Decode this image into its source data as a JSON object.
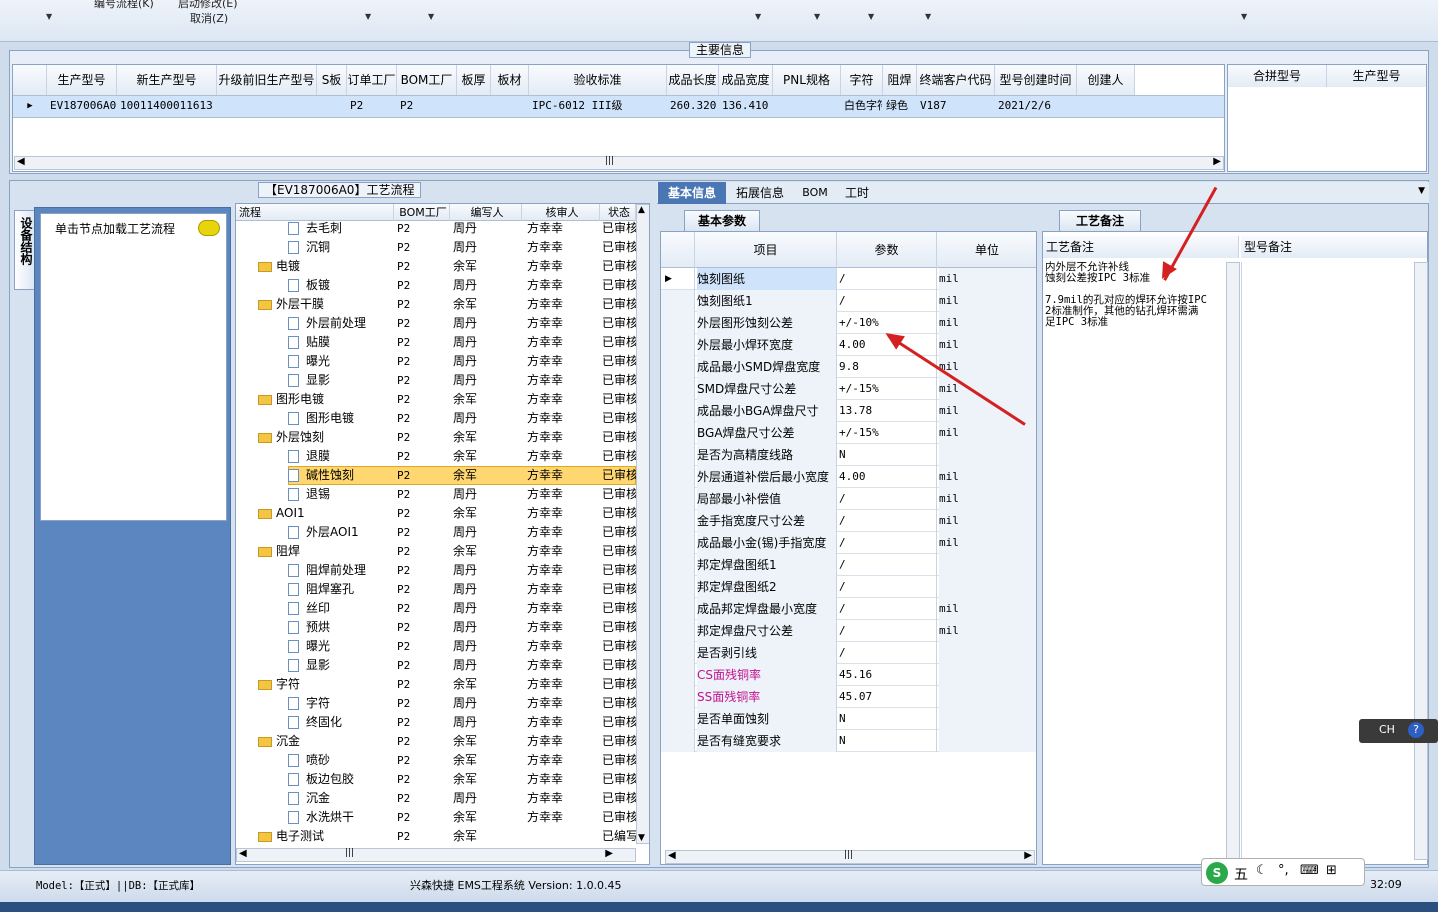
{
  "toolbar": {
    "menu1": "编号流程(K)",
    "menu2": "启动修改(E)",
    "cancel": "取消(Z)"
  },
  "main_info": {
    "group_label": "主要信息",
    "columns": [
      "生产型号",
      "新生产型号",
      "升级前旧生产型号",
      "S板",
      "订单工厂",
      "BOM工厂",
      "板厚",
      "板材",
      "验收标准",
      "成品长度",
      "成品宽度",
      "PNL规格",
      "字符",
      "阻焊",
      "终端客户代码",
      "型号创建时间",
      "创建人"
    ],
    "row": [
      "EV187006A0",
      "10011400011613",
      "",
      "",
      "P2",
      "P2",
      "",
      "",
      "IPC-6012 III级",
      "260.320",
      "136.410",
      "",
      "白色字符",
      "绿色",
      "V187",
      "2021/2/6",
      ""
    ],
    "merge_columns": [
      "合拼型号",
      "生产型号"
    ]
  },
  "left_panel": {
    "vertical_tab": "设备结构",
    "hint": "单击节点加载工艺流程"
  },
  "process": {
    "group_label": "【EV187006A0】工艺流程",
    "columns": [
      "流程",
      "BOM工厂",
      "编写人",
      "核审人",
      "状态"
    ],
    "rows": [
      {
        "name": "去毛刺",
        "level": 2,
        "f": "P2",
        "w": "周丹",
        "r": "方幸幸",
        "s": "已审核"
      },
      {
        "name": "沉铜",
        "level": 2,
        "f": "P2",
        "w": "周丹",
        "r": "方幸幸",
        "s": "已审核"
      },
      {
        "name": "电镀",
        "level": 1,
        "f": "P2",
        "w": "余军",
        "r": "方幸幸",
        "s": "已审核"
      },
      {
        "name": "板镀",
        "level": 2,
        "f": "P2",
        "w": "周丹",
        "r": "方幸幸",
        "s": "已审核"
      },
      {
        "name": "外层干膜",
        "level": 1,
        "f": "P2",
        "w": "余军",
        "r": "方幸幸",
        "s": "已审核"
      },
      {
        "name": "外层前处理",
        "level": 2,
        "f": "P2",
        "w": "周丹",
        "r": "方幸幸",
        "s": "已审核"
      },
      {
        "name": "贴膜",
        "level": 2,
        "f": "P2",
        "w": "周丹",
        "r": "方幸幸",
        "s": "已审核"
      },
      {
        "name": "曝光",
        "level": 2,
        "f": "P2",
        "w": "周丹",
        "r": "方幸幸",
        "s": "已审核"
      },
      {
        "name": "显影",
        "level": 2,
        "f": "P2",
        "w": "周丹",
        "r": "方幸幸",
        "s": "已审核"
      },
      {
        "name": "图形电镀",
        "level": 1,
        "f": "P2",
        "w": "余军",
        "r": "方幸幸",
        "s": "已审核"
      },
      {
        "name": "图形电镀",
        "level": 2,
        "f": "P2",
        "w": "周丹",
        "r": "方幸幸",
        "s": "已审核"
      },
      {
        "name": "外层蚀刻",
        "level": 1,
        "f": "P2",
        "w": "余军",
        "r": "方幸幸",
        "s": "已审核"
      },
      {
        "name": "退膜",
        "level": 2,
        "f": "P2",
        "w": "余军",
        "r": "方幸幸",
        "s": "已审核"
      },
      {
        "name": "碱性蚀刻",
        "level": 2,
        "f": "P2",
        "w": "余军",
        "r": "方幸幸",
        "s": "已审核",
        "sel": true
      },
      {
        "name": "退锡",
        "level": 2,
        "f": "P2",
        "w": "周丹",
        "r": "方幸幸",
        "s": "已审核"
      },
      {
        "name": "AOI1",
        "level": 1,
        "f": "P2",
        "w": "余军",
        "r": "方幸幸",
        "s": "已审核"
      },
      {
        "name": "外层AOI1",
        "level": 2,
        "f": "P2",
        "w": "周丹",
        "r": "方幸幸",
        "s": "已审核"
      },
      {
        "name": "阻焊",
        "level": 1,
        "f": "P2",
        "w": "余军",
        "r": "方幸幸",
        "s": "已审核"
      },
      {
        "name": "阻焊前处理",
        "level": 2,
        "f": "P2",
        "w": "周丹",
        "r": "方幸幸",
        "s": "已审核"
      },
      {
        "name": "阻焊塞孔",
        "level": 2,
        "f": "P2",
        "w": "周丹",
        "r": "方幸幸",
        "s": "已审核"
      },
      {
        "name": "丝印",
        "level": 2,
        "f": "P2",
        "w": "周丹",
        "r": "方幸幸",
        "s": "已审核"
      },
      {
        "name": "预烘",
        "level": 2,
        "f": "P2",
        "w": "周丹",
        "r": "方幸幸",
        "s": "已审核"
      },
      {
        "name": "曝光",
        "level": 2,
        "f": "P2",
        "w": "周丹",
        "r": "方幸幸",
        "s": "已审核"
      },
      {
        "name": "显影",
        "level": 2,
        "f": "P2",
        "w": "周丹",
        "r": "方幸幸",
        "s": "已审核"
      },
      {
        "name": "字符",
        "level": 1,
        "f": "P2",
        "w": "余军",
        "r": "方幸幸",
        "s": "已审核"
      },
      {
        "name": "字符",
        "level": 2,
        "f": "P2",
        "w": "周丹",
        "r": "方幸幸",
        "s": "已审核"
      },
      {
        "name": "终固化",
        "level": 2,
        "f": "P2",
        "w": "周丹",
        "r": "方幸幸",
        "s": "已审核"
      },
      {
        "name": "沉金",
        "level": 1,
        "f": "P2",
        "w": "余军",
        "r": "方幸幸",
        "s": "已审核"
      },
      {
        "name": "喷砂",
        "level": 2,
        "f": "P2",
        "w": "余军",
        "r": "方幸幸",
        "s": "已审核"
      },
      {
        "name": "板边包胶",
        "level": 2,
        "f": "P2",
        "w": "余军",
        "r": "方幸幸",
        "s": "已审核"
      },
      {
        "name": "沉金",
        "level": 2,
        "f": "P2",
        "w": "周丹",
        "r": "方幸幸",
        "s": "已审核"
      },
      {
        "name": "水洗烘干",
        "level": 2,
        "f": "P2",
        "w": "余军",
        "r": "方幸幸",
        "s": "已审核"
      },
      {
        "name": "电子测试",
        "level": 1,
        "f": "P2",
        "w": "余军",
        "r": "",
        "s": "已编写"
      }
    ]
  },
  "tabs": [
    "基本信息",
    "拓展信息",
    "BOM",
    "工时"
  ],
  "basic_params": {
    "tab": "基本参数",
    "columns": [
      "项目",
      "参数",
      "单位"
    ],
    "rows": [
      {
        "item": "蚀刻图纸",
        "val": "/",
        "unit": "mil"
      },
      {
        "item": "蚀刻图纸1",
        "val": "/",
        "unit": "mil"
      },
      {
        "item": "外层图形蚀刻公差",
        "val": "+/-10%",
        "unit": "mil"
      },
      {
        "item": "外层最小焊环宽度",
        "val": "4.00",
        "unit": "mil"
      },
      {
        "item": "成品最小SMD焊盘宽度",
        "val": "9.8",
        "unit": "mil"
      },
      {
        "item": "SMD焊盘尺寸公差",
        "val": "+/-15%",
        "unit": "mil"
      },
      {
        "item": "成品最小BGA焊盘尺寸",
        "val": "13.78",
        "unit": "mil"
      },
      {
        "item": "BGA焊盘尺寸公差",
        "val": "+/-15%",
        "unit": "mil"
      },
      {
        "item": "是否为高精度线路",
        "val": "N",
        "unit": ""
      },
      {
        "item": "外层通道补偿后最小宽度",
        "val": "4.00",
        "unit": "mil"
      },
      {
        "item": "局部最小补偿值",
        "val": "/",
        "unit": "mil"
      },
      {
        "item": "金手指宽度尺寸公差",
        "val": "/",
        "unit": "mil"
      },
      {
        "item": "成品最小金(锡)手指宽度",
        "val": "/",
        "unit": "mil"
      },
      {
        "item": "邦定焊盘图纸1",
        "val": "/",
        "unit": ""
      },
      {
        "item": "邦定焊盘图纸2",
        "val": "/",
        "unit": ""
      },
      {
        "item": "成品邦定焊盘最小宽度",
        "val": "/",
        "unit": "mil"
      },
      {
        "item": "邦定焊盘尺寸公差",
        "val": "/",
        "unit": "mil"
      },
      {
        "item": "是否剥引线",
        "val": "/",
        "unit": ""
      },
      {
        "item": "CS面残铜率",
        "val": "45.16",
        "unit": "",
        "pink": true
      },
      {
        "item": "SS面残铜率",
        "val": "45.07",
        "unit": "",
        "pink": true
      },
      {
        "item": "是否单面蚀刻",
        "val": "N",
        "unit": ""
      },
      {
        "item": "是否有缝宽要求",
        "val": "N",
        "unit": ""
      }
    ]
  },
  "remarks": {
    "tab": "工艺备注",
    "col1": "工艺备注",
    "col2": "型号备注",
    "text": [
      "内外层不允许补线",
      "蚀刻公差按IPC 3标准",
      "",
      "7.9mil的孔对应的焊环允许按IPC",
      "2标准制作，其他的钻孔焊环需满",
      "足IPC 3标准"
    ]
  },
  "statusbar": {
    "left": "Model:【正式】||DB:【正式库】",
    "center": "兴森快捷 EMS工程系统 Version: 1.0.0.45",
    "time": "32:09"
  },
  "ime": {
    "lang": "CH",
    "mode": "五"
  },
  "colors": {
    "selected_row": "#cfe3fb",
    "tree_selected": "#ffd770",
    "pink_text": "#c2138f",
    "arrow": "#d42020"
  }
}
